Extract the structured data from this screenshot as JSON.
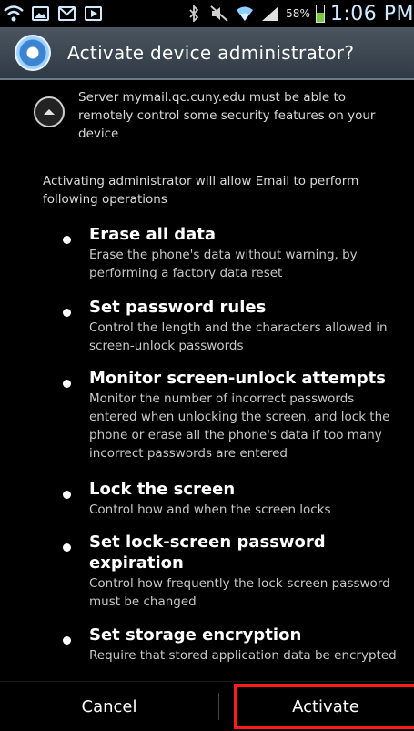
{
  "status_bar": {
    "battery_percent": "58%",
    "battery_level": 0.58,
    "time": "1:06 PM",
    "icons": [
      "wifi-icon",
      "image-icon",
      "gmail-icon",
      "play-store-icon",
      "bluetooth-icon",
      "mute-icon",
      "wifi-signal-icon",
      "cell-signal-icon",
      "battery-icon"
    ]
  },
  "dialog": {
    "title": "Activate device administrator?",
    "icon": "gear-icon",
    "server_message": "Server mymail.qc.cuny.edu must be able to remotely control some security features on your device",
    "intro": "Activating administrator will allow Email to perform following operations",
    "policies": [
      {
        "title": "Erase all data",
        "description": "Erase the phone's data without warning, by performing a factory data reset"
      },
      {
        "title": "Set password rules",
        "description": "Control the length and the characters allowed in screen-unlock passwords"
      },
      {
        "title": "Monitor screen-unlock attempts",
        "description": "Monitor the number of incorrect passwords entered when unlocking the screen, and lock the phone or erase all the phone's data if too many incorrect passwords are entered"
      },
      {
        "title": "Lock the screen",
        "description": "Control how and when the screen locks"
      },
      {
        "title": "Set lock-screen password expiration",
        "description": "Control how frequently the lock-screen password must be changed"
      },
      {
        "title": "Set storage encryption",
        "description": "Require that stored application data be encrypted"
      }
    ]
  },
  "buttons": {
    "cancel": "Cancel",
    "activate": "Activate"
  },
  "colors": {
    "accent": "#3b84d2",
    "highlight": "#ff1a1a",
    "battery": "#7ac943"
  }
}
